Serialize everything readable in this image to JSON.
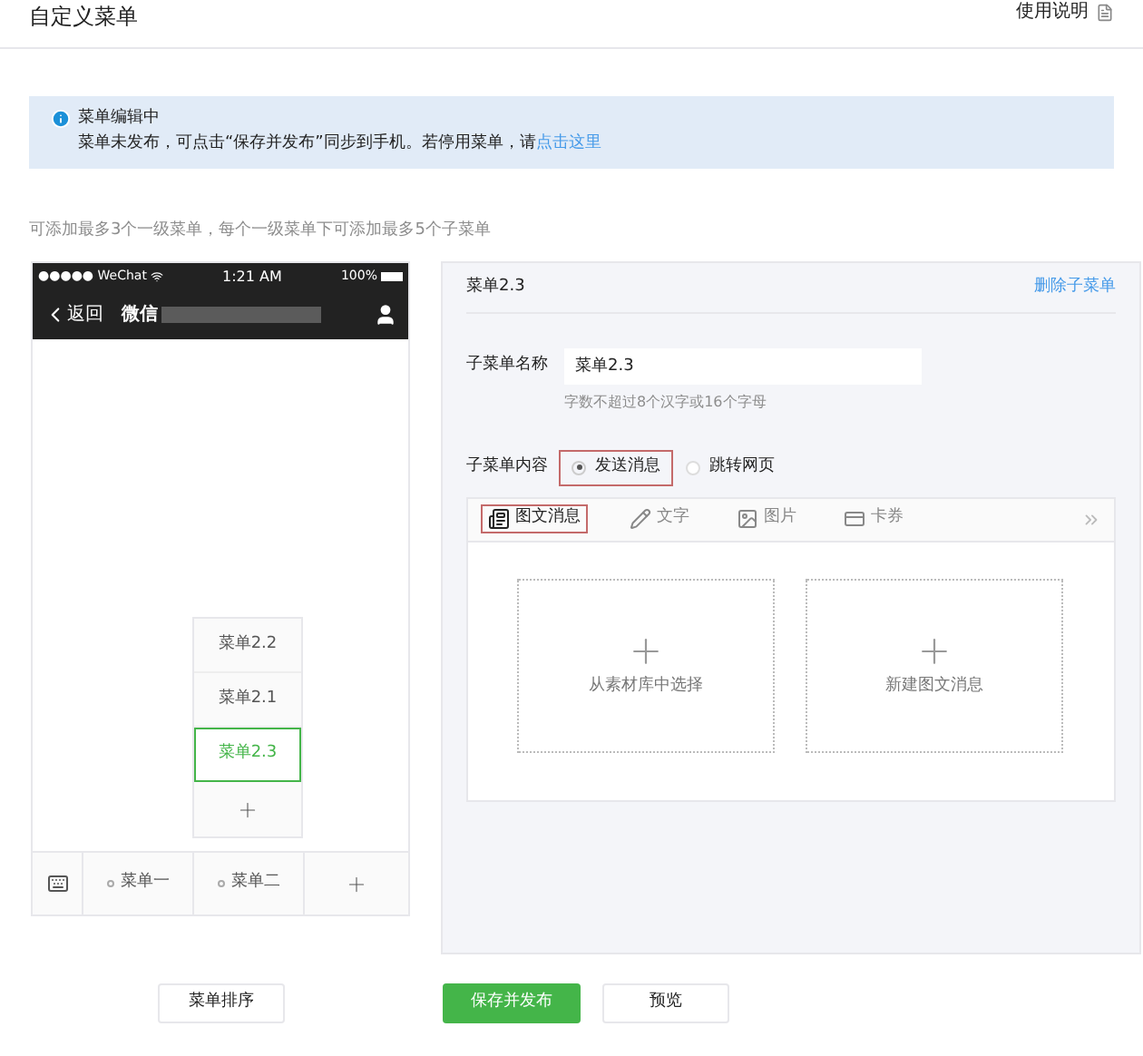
{
  "header": {
    "title": "自定义菜单",
    "help_link": "使用说明"
  },
  "notice": {
    "title": "菜单编辑中",
    "text": "菜单未发布，可点击“保存并发布”同步到手机。若停用菜单，请",
    "link": "点击这里"
  },
  "hint": "可添加最多3个一级菜单，每个一级菜单下可添加最多5个子菜单",
  "phone": {
    "carrier": "●●●●● WeChat",
    "time": "1:21 AM",
    "battery": "100%",
    "back": "返回",
    "title": "微信",
    "submenu": [
      {
        "label": "菜单2.2",
        "selected": false
      },
      {
        "label": "菜单2.1",
        "selected": false
      },
      {
        "label": "菜单2.3",
        "selected": true
      }
    ],
    "menu": [
      {
        "label": "菜单一"
      },
      {
        "label": "菜单二"
      }
    ]
  },
  "editor": {
    "title": "菜单2.3",
    "delete_link": "删除子菜单",
    "name_label": "子菜单名称",
    "name_value": "菜单2.3",
    "name_hint": "字数不超过8个汉字或16个字母",
    "content_label": "子菜单内容",
    "content_options": [
      {
        "label": "发送消息",
        "selected": true
      },
      {
        "label": "跳转网页",
        "selected": false
      }
    ],
    "tabs": [
      {
        "label": "图文消息",
        "kind": "news",
        "selected": true
      },
      {
        "label": "文字",
        "kind": "text",
        "selected": false
      },
      {
        "label": "图片",
        "kind": "image",
        "selected": false
      },
      {
        "label": "卡券",
        "kind": "card",
        "selected": false
      }
    ],
    "cards": [
      {
        "label": "从素材库中选择"
      },
      {
        "label": "新建图文消息"
      }
    ]
  },
  "buttons": [
    {
      "label": "菜单排序",
      "kind": "default"
    },
    {
      "label": "保存并发布",
      "kind": "primary"
    },
    {
      "label": "预览",
      "kind": "default"
    }
  ]
}
